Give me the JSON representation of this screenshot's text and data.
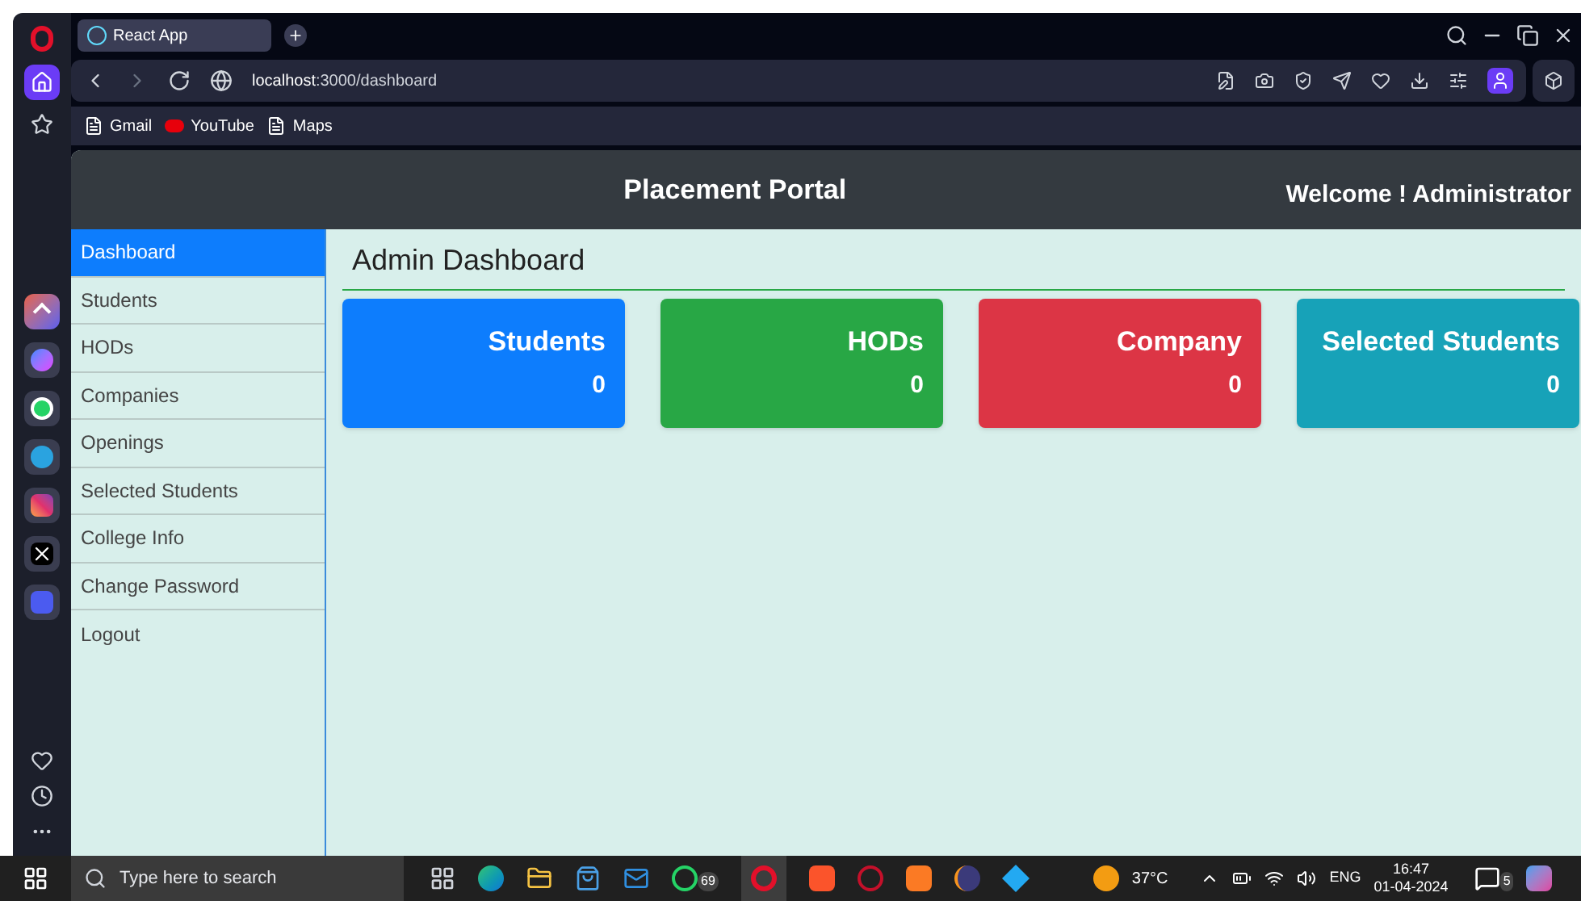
{
  "browser": {
    "tab_title": "React App",
    "url_host": "localhost",
    "url_path": ":3000/dashboard",
    "bookmarks": [
      "Gmail",
      "YouTube",
      "Maps"
    ]
  },
  "header": {
    "title": "Placement Portal",
    "welcome": "Welcome ! Administrator"
  },
  "sidebar": {
    "items": [
      {
        "label": "Dashboard",
        "selected": true
      },
      {
        "label": "Students",
        "selected": false
      },
      {
        "label": "HODs",
        "selected": false
      },
      {
        "label": "Companies",
        "selected": false
      },
      {
        "label": "Openings",
        "selected": false
      },
      {
        "label": "Selected Students",
        "selected": false
      },
      {
        "label": "College Info",
        "selected": false
      },
      {
        "label": "Change Password",
        "selected": false
      },
      {
        "label": "Logout",
        "selected": false
      }
    ]
  },
  "main": {
    "title": "Admin Dashboard",
    "cards": [
      {
        "title": "Students",
        "count": "0",
        "color": "#0d7dfd"
      },
      {
        "title": "HODs",
        "count": "0",
        "color": "#28a745"
      },
      {
        "title": "Company",
        "count": "0",
        "color": "#dc3545"
      },
      {
        "title": "Selected Students",
        "count": "0",
        "color": "#17a2b8"
      }
    ]
  },
  "taskbar": {
    "search_placeholder": "Type here to search",
    "whatsapp_badge": "69",
    "temperature": "37°C",
    "language": "ENG",
    "time": "16:47",
    "date": "01-04-2024",
    "notification_count": "5"
  }
}
